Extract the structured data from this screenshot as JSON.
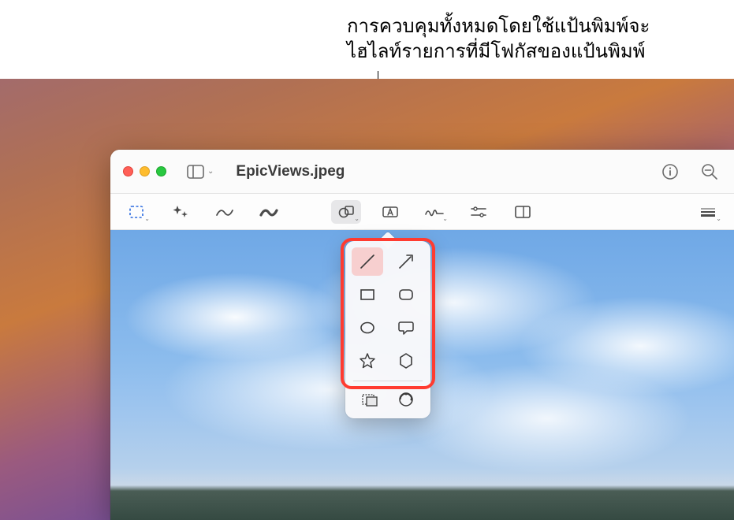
{
  "callout": {
    "line1": "การควบคุมทั้งหมดโดยใช้แป้นพิมพ์จะ",
    "line2": "ไฮไลท์รายการที่มีโฟกัสของแป้นพิมพ์"
  },
  "window": {
    "title": "EpicViews.jpeg"
  },
  "toolbar": {
    "tools": [
      {
        "name": "selection-tool"
      },
      {
        "name": "magic-select-tool"
      },
      {
        "name": "sketch-tool"
      },
      {
        "name": "draw-tool"
      },
      {
        "name": "shapes-tool"
      },
      {
        "name": "text-tool"
      },
      {
        "name": "sign-tool"
      },
      {
        "name": "adjust-color-tool"
      },
      {
        "name": "crop-tool"
      },
      {
        "name": "border-style-tool"
      }
    ]
  },
  "popover": {
    "shapes": [
      "line",
      "arrow",
      "rectangle",
      "rounded-rectangle",
      "oval",
      "speech-bubble",
      "star",
      "hexagon"
    ],
    "extras": [
      "mask",
      "loupe"
    ]
  }
}
